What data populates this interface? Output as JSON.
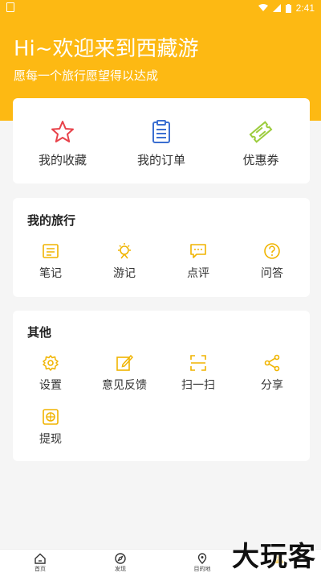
{
  "status_bar": {
    "time": "2:41"
  },
  "header": {
    "title": "Hi~欢迎来到西藏游",
    "subtitle": "愿每一个旅行愿望得以达成"
  },
  "quick_actions": [
    {
      "label": "我的收藏",
      "icon": "star-icon"
    },
    {
      "label": "我的订单",
      "icon": "clipboard-icon"
    },
    {
      "label": "优惠券",
      "icon": "ticket-icon"
    }
  ],
  "my_travel": {
    "title": "我的旅行",
    "items": [
      {
        "label": "笔记",
        "icon": "note-icon"
      },
      {
        "label": "游记",
        "icon": "sun-icon"
      },
      {
        "label": "点评",
        "icon": "comment-icon"
      },
      {
        "label": "问答",
        "icon": "question-icon"
      }
    ]
  },
  "other": {
    "title": "其他",
    "items": [
      {
        "label": "设置",
        "icon": "gear-icon"
      },
      {
        "label": "意见反馈",
        "icon": "edit-icon"
      },
      {
        "label": "扫一扫",
        "icon": "scan-icon"
      },
      {
        "label": "分享",
        "icon": "share-icon"
      },
      {
        "label": "提现",
        "icon": "withdraw-icon"
      }
    ]
  },
  "tabbar": [
    {
      "label": "首页",
      "icon": "home-icon"
    },
    {
      "label": "发现",
      "icon": "compass-icon"
    },
    {
      "label": "目的地",
      "icon": "location-icon"
    }
  ],
  "watermark": "大玩客",
  "colors": {
    "accent": "#fdb913",
    "star": "#e8424a",
    "clipboard": "#3b6fd1",
    "ticket": "#9ccc3d"
  }
}
